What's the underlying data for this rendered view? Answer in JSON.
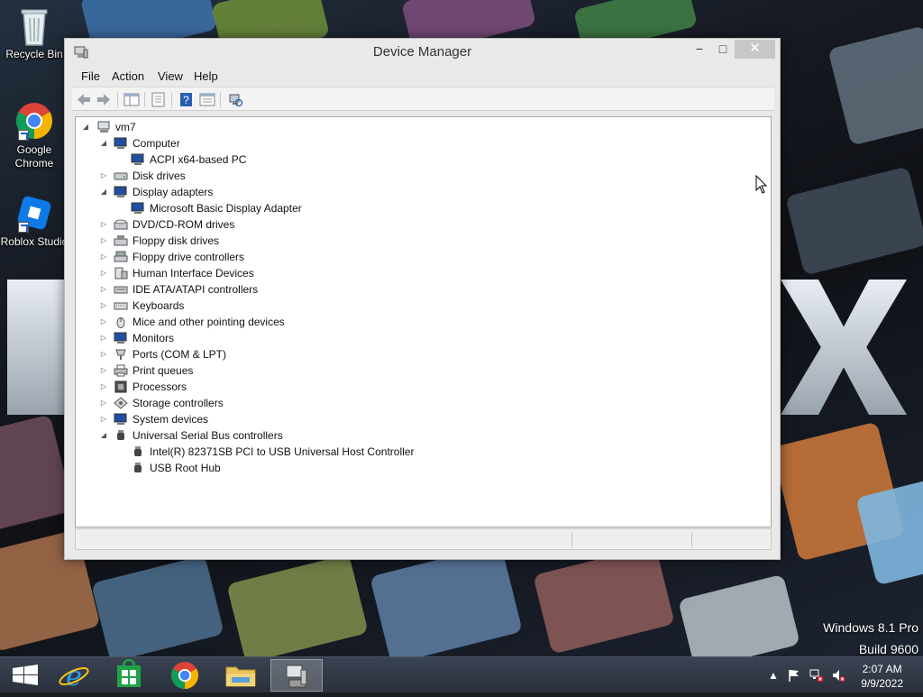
{
  "window": {
    "title": "Device Manager",
    "controls": {
      "minimize": "−",
      "maximize": "□",
      "close": "✕"
    }
  },
  "menu": {
    "file": "File",
    "action": "Action",
    "view": "View",
    "help": "Help"
  },
  "toolbar_icons": [
    "back-arrow-icon",
    "forward-arrow-icon",
    "show-hide-console-tree-icon",
    "properties-icon",
    "help-icon",
    "update-driver-icon",
    "scan-hardware-icon"
  ],
  "tree": {
    "root": "vm7",
    "computer": "Computer",
    "computer_child": "ACPI x64-based PC",
    "disk_drives": "Disk drives",
    "display_adapters": "Display adapters",
    "display_child": "Microsoft Basic Display Adapter",
    "dvd": "DVD/CD-ROM drives",
    "floppy_disk": "Floppy disk drives",
    "floppy_ctrl": "Floppy drive controllers",
    "hid": "Human Interface Devices",
    "ide": "IDE ATA/ATAPI controllers",
    "keyboards": "Keyboards",
    "mice": "Mice and other pointing devices",
    "monitors": "Monitors",
    "ports": "Ports (COM & LPT)",
    "print": "Print queues",
    "processors": "Processors",
    "storage": "Storage controllers",
    "system": "System devices",
    "usb": "Universal Serial Bus controllers",
    "usb_child1": "Intel(R) 82371SB PCI to USB Universal Host Controller",
    "usb_child2": "USB Root Hub"
  },
  "desktop": {
    "recycle_bin": "Recycle Bin",
    "chrome": "Google Chrome",
    "roblox": "Roblox Studio"
  },
  "watermark": {
    "line1": "Windows 8.1 Pro",
    "line2": "Build 9600"
  },
  "taskbar": {
    "apps": [
      "windows-start",
      "internet-explorer",
      "store",
      "chrome",
      "file-explorer",
      "device-manager"
    ],
    "time": "2:07 AM",
    "date": "9/9/2022"
  },
  "colors": {
    "accent": "#1a5fc4",
    "taskbar": "#2e3542"
  }
}
